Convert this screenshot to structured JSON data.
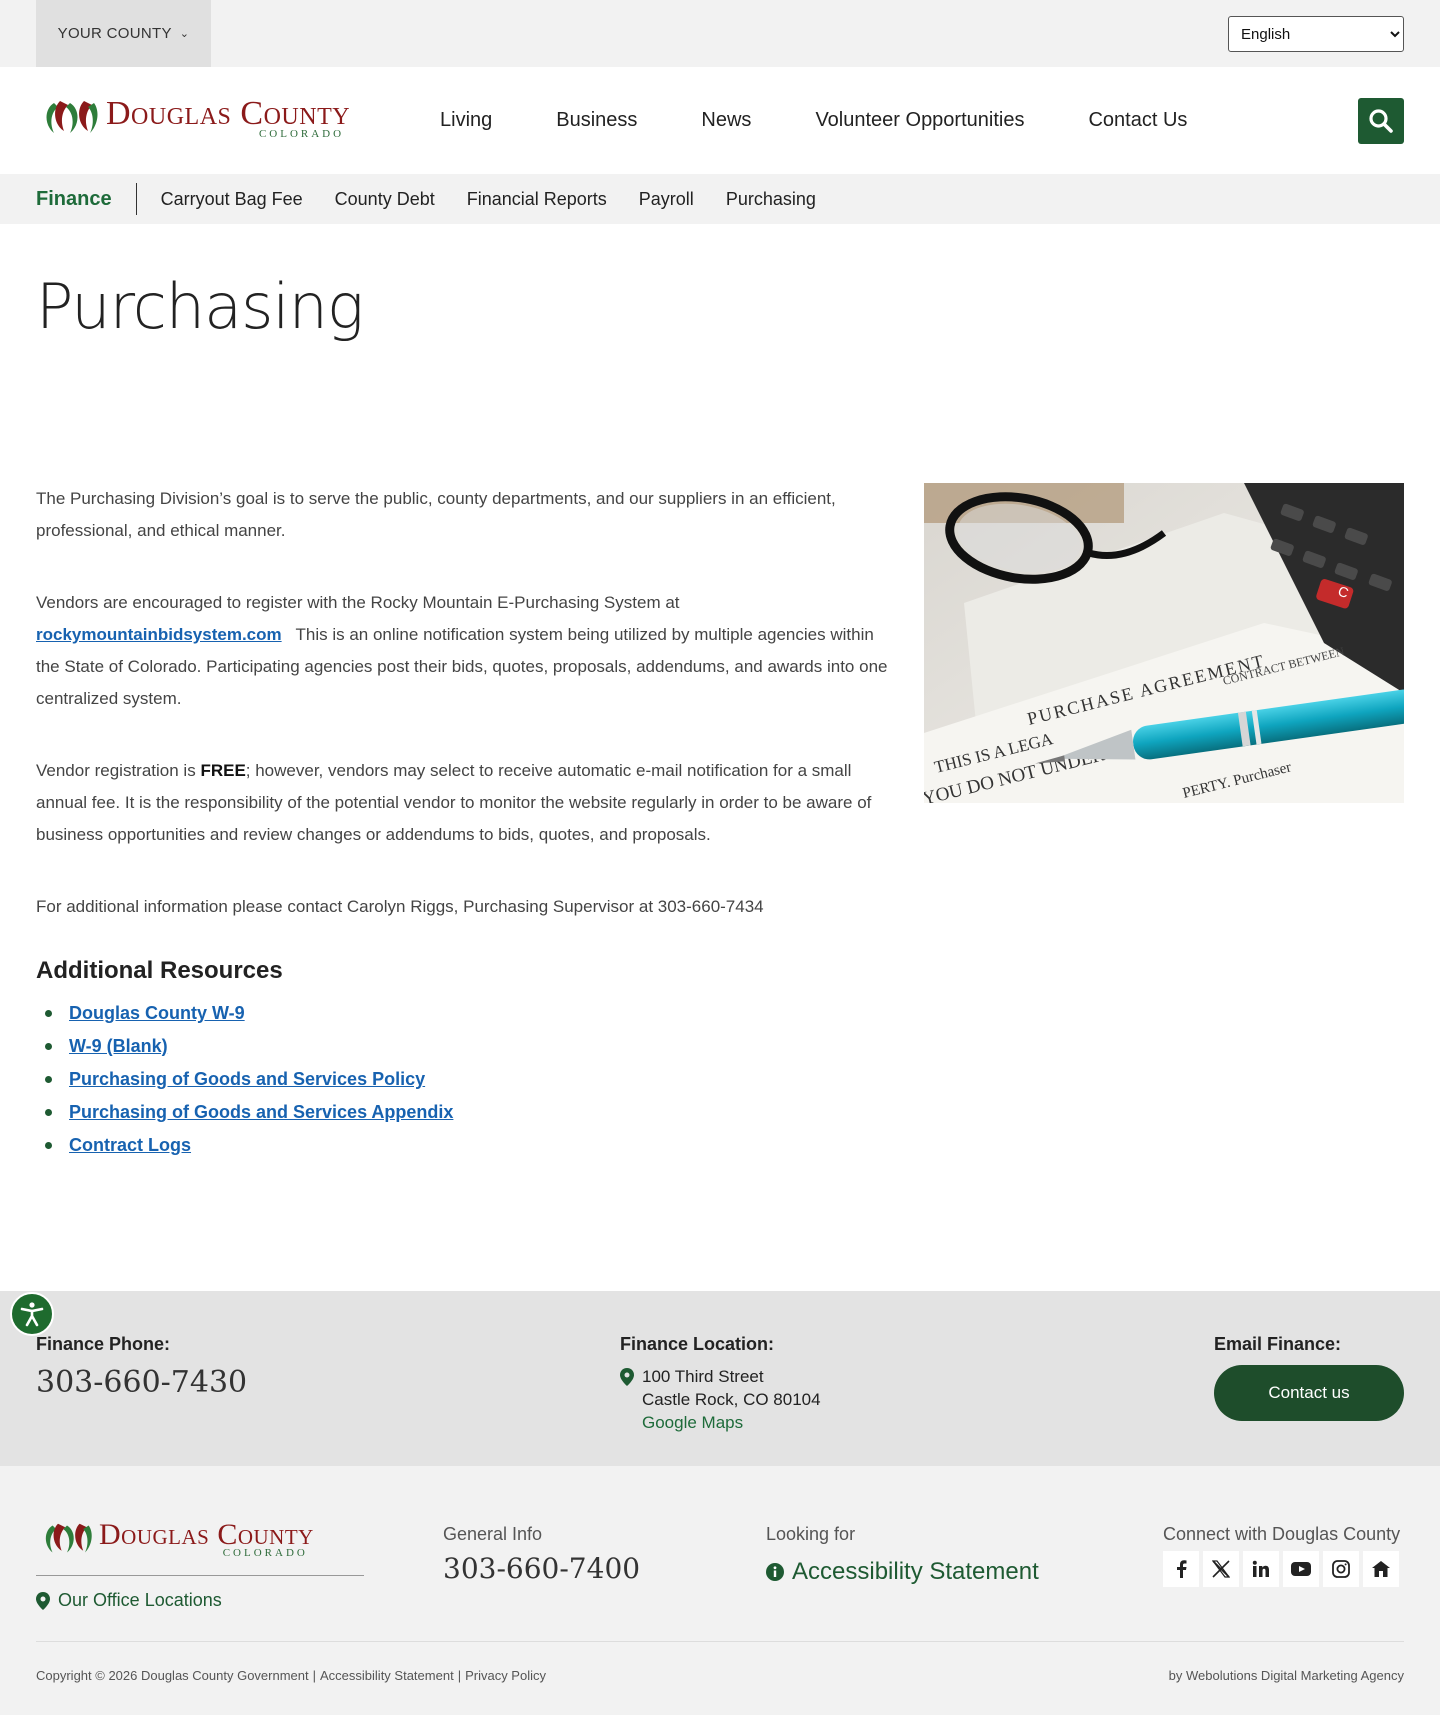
{
  "utility": {
    "county_label": "YOUR COUNTY",
    "language_options": [
      "English"
    ],
    "language_selected": "English"
  },
  "header": {
    "logo_name": "Douglas County",
    "logo_sub": "COLORADO",
    "nav": [
      "Living",
      "Business",
      "News",
      "Volunteer Opportunities",
      "Contact Us"
    ]
  },
  "subnav": {
    "section": "Finance",
    "links": [
      "Carryout Bag Fee",
      "County Debt",
      "Financial Reports",
      "Payroll",
      "Purchasing"
    ]
  },
  "main": {
    "title": "Purchasing",
    "p1": "The Purchasing Division’s goal is to serve the public, county departments, and our suppliers in an efficient, professional, and ethical manner.",
    "p2_a": "Vendors are encouraged to register with the Rocky Mountain E-Purchasing System at",
    "p2_link": "rockymountainbidsystem.com",
    "p2_b": "This is an online notification system being utilized by multiple agencies within the State of Colorado.  Participating agencies post their bids, quotes, proposals, addendums, and awards into one centralized system.",
    "p3_a": "Vendor registration is",
    "p3_free": "FREE",
    "p3_b": "; however, vendors may select to receive automatic e-mail notification for a small annual fee.  It is the responsibility of the potential vendor to monitor the website regularly in order to be aware of business opportunities and review changes or addendums to bids, quotes, and proposals.",
    "p4": "For additional information please contact Carolyn Riggs, Purchasing Supervisor at 303-660-7434",
    "resources_title": "Additional Resources",
    "resources": [
      "Douglas County W-9",
      "W-9 (Blank)",
      "Purchasing of Goods and Services Policy",
      "Purchasing of Goods and Services Appendix",
      "Contract Logs"
    ],
    "image_text": {
      "heading": "PURCHASE AGREEMENT",
      "line1": "CONTRACT BETWEEN",
      "line2": "THIS IS A LEGA",
      "line3": "YOU DO NOT UNDERST",
      "line4": "PERTY. Purchaser",
      "key": "C"
    }
  },
  "contact_band": {
    "phone_label": "Finance Phone:",
    "phone": "303-660-7430",
    "location_label": "Finance Location:",
    "address_1": "100 Third Street",
    "address_2": "Castle Rock, CO 80104",
    "maps_link": "Google Maps",
    "email_label": "Email Finance:",
    "contact_button": "Contact us"
  },
  "footer": {
    "logo_name": "Douglas County",
    "logo_sub": "COLORADO",
    "office_link": "Our Office Locations",
    "general_label": "General Info",
    "general_phone": "303-660-7400",
    "looking_label": "Looking for",
    "a11y_link": "Accessibility Statement",
    "connect_label": "Connect with Douglas County",
    "socials": [
      "facebook-icon",
      "x-icon",
      "linkedin-icon",
      "youtube-icon",
      "instagram-icon",
      "nextdoor-icon"
    ],
    "copyright": "Copyright © 2026 Douglas County Government",
    "copyright_a11y": "Accessibility Statement",
    "privacy": "Privacy Policy",
    "credit": "by Webolutions Digital Marketing Agency"
  },
  "colors": {
    "brand_green": "#1e5a32",
    "brand_red": "#8b1a1a",
    "link_blue": "#1762b0"
  }
}
